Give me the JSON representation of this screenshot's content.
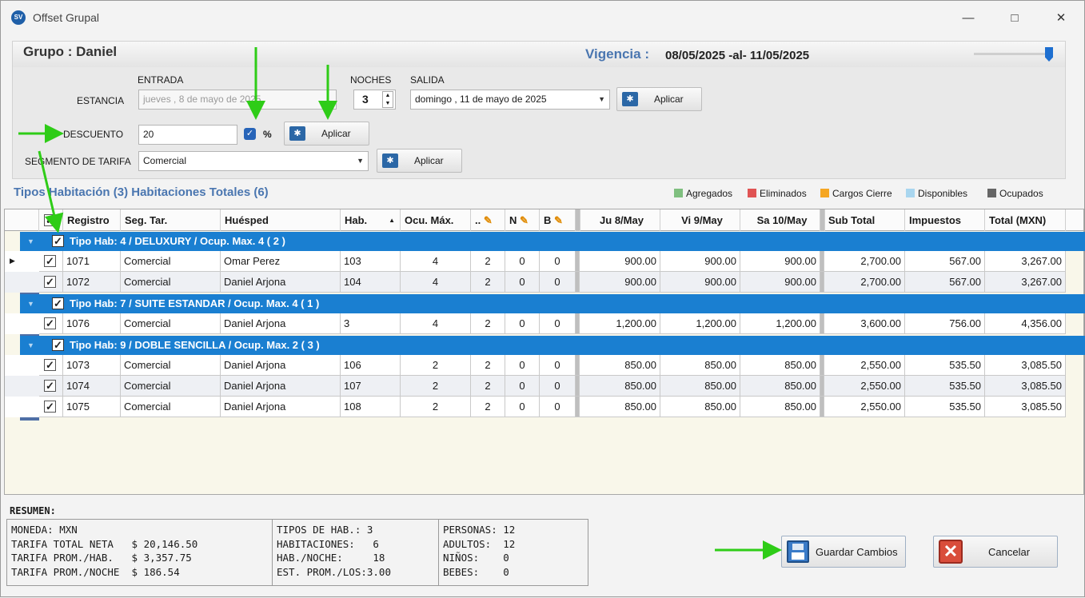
{
  "window": {
    "title": "Offset Grupal",
    "app_badge": "SV"
  },
  "header": {
    "grupo": "Grupo : Daniel",
    "vigencia_label": "Vigencia :",
    "vigencia_value": "08/05/2025 -al- 11/05/2025"
  },
  "estancia": {
    "label": "ESTANCIA",
    "entrada_label": "ENTRADA",
    "entrada_value": "jueves  ,   8 de     mayo      de 2025",
    "noches_label": "NOCHES",
    "noches_value": "3",
    "salida_label": "SALIDA",
    "salida_value": "domingo , 11 de     mayo      de 2025",
    "apply_label": "Aplicar"
  },
  "descuento": {
    "label": "DESCUENTO",
    "value": "20",
    "percent_label": "%",
    "percent_checked": true,
    "apply_label": "Aplicar"
  },
  "segmento": {
    "label": "SEGMENTO DE TARIFA",
    "value": "Comercial",
    "apply_label": "Aplicar"
  },
  "tipos_title": "Tipos Habitación (3) Habitaciones Totales (6)",
  "legend": [
    {
      "label": "Agregados",
      "color": "#7fbf7f"
    },
    {
      "label": "Eliminados",
      "color": "#e05454"
    },
    {
      "label": "Cargos Cierre",
      "color": "#f5a623"
    },
    {
      "label": "Disponibles",
      "color": "#a9d6ef"
    },
    {
      "label": "Ocupados",
      "color": "#666666"
    }
  ],
  "columns": [
    "Registro",
    "Seg. Tar.",
    "Huésped",
    "Hab.",
    "Ocu. Máx.",
    "..",
    "N",
    "B",
    "Ju 8/May",
    "Vi 9/May",
    "Sa 10/May",
    "Sub Total",
    "Impuestos",
    "Total (MXN)"
  ],
  "groups": [
    {
      "title": "Tipo Hab: 4 / DELUXURY / Ocup. Max.  4 ( 2 )",
      "rows": [
        [
          "1071",
          "Comercial",
          "Omar Perez",
          "103",
          "4",
          "2",
          "0",
          "0",
          "900.00",
          "900.00",
          "900.00",
          "2,700.00",
          "567.00",
          "3,267.00"
        ],
        [
          "1072",
          "Comercial",
          "Daniel Arjona",
          "104",
          "4",
          "2",
          "0",
          "0",
          "900.00",
          "900.00",
          "900.00",
          "2,700.00",
          "567.00",
          "3,267.00"
        ]
      ]
    },
    {
      "title": "Tipo Hab: 7 / SUITE ESTANDAR / Ocup. Max.  4 ( 1 )",
      "rows": [
        [
          "1076",
          "Comercial",
          "Daniel Arjona",
          "3",
          "4",
          "2",
          "0",
          "0",
          "1,200.00",
          "1,200.00",
          "1,200.00",
          "3,600.00",
          "756.00",
          "4,356.00"
        ]
      ]
    },
    {
      "title": "Tipo Hab: 9 / DOBLE SENCILLA / Ocup. Max.  2 ( 3 )",
      "rows": [
        [
          "1073",
          "Comercial",
          "Daniel Arjona",
          "106",
          "2",
          "2",
          "0",
          "0",
          "850.00",
          "850.00",
          "850.00",
          "2,550.00",
          "535.50",
          "3,085.50"
        ],
        [
          "1074",
          "Comercial",
          "Daniel Arjona",
          "107",
          "2",
          "2",
          "0",
          "0",
          "850.00",
          "850.00",
          "850.00",
          "2,550.00",
          "535.50",
          "3,085.50"
        ],
        [
          "1075",
          "Comercial",
          "Daniel Arjona",
          "108",
          "2",
          "2",
          "0",
          "0",
          "850.00",
          "850.00",
          "850.00",
          "2,550.00",
          "535.50",
          "3,085.50"
        ]
      ]
    }
  ],
  "resumen": {
    "label": "RESUMEN:",
    "col1": "MONEDA: MXN\nTARIFA TOTAL NETA   $ 20,146.50\nTARIFA PROM./HAB.   $ 3,357.75\nTARIFA PROM./NOCHE  $ 186.54",
    "col2": "TIPOS DE HAB.: 3\nHABITACIONES:   6\nHAB./NOCHE:     18\nEST. PROM./LOS:3.00",
    "col3": "PERSONAS: 12\nADULTOS:  12\nNIÑOS:    0\nBEBES:    0"
  },
  "actions": {
    "save_label": "Guardar Cambios",
    "cancel_label": "Cancelar"
  }
}
